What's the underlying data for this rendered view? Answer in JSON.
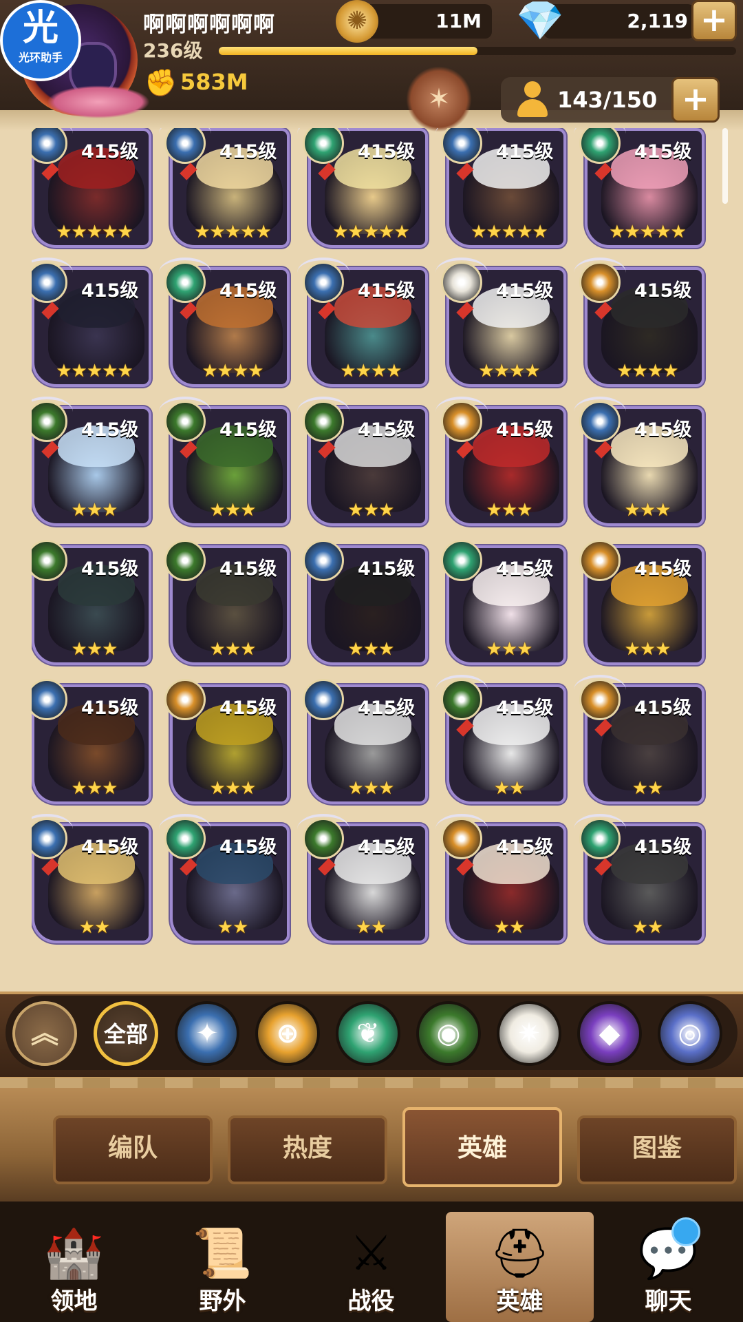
{
  "player": {
    "name": "啊啊啊啊啊啊",
    "level": "236级",
    "xp_progress": 0.5,
    "power": "583M"
  },
  "badge": {
    "glyph": "光",
    "text": "光环助手"
  },
  "currency": {
    "gold": "11M",
    "gems": "2,119",
    "plus": "+"
  },
  "roster": {
    "count": "143/150",
    "plus": "+"
  },
  "heroes": [
    {
      "level": "415级",
      "stars": "★★★★★",
      "faction": "lightbearer",
      "wings": true
    },
    {
      "level": "415级",
      "stars": "★★★★★",
      "faction": "lightbearer",
      "wings": true
    },
    {
      "level": "415级",
      "stars": "★★★★★",
      "faction": "wilder",
      "wings": true
    },
    {
      "level": "415级",
      "stars": "★★★★★",
      "faction": "lightbearer",
      "wings": true
    },
    {
      "level": "415级",
      "stars": "★★★★★",
      "faction": "wilder",
      "wings": true
    },
    {
      "level": "415级",
      "stars": "★★★★★",
      "faction": "lightbearer",
      "wings": true
    },
    {
      "level": "415级",
      "stars": "★★★★",
      "faction": "wilder",
      "wings": true
    },
    {
      "level": "415级",
      "stars": "★★★★",
      "faction": "lightbearer",
      "wings": true
    },
    {
      "level": "415级",
      "stars": "★★★★",
      "faction": "celestial",
      "wings": true
    },
    {
      "level": "415级",
      "stars": "★★★★",
      "faction": "mauler",
      "wings": true
    },
    {
      "level": "415级",
      "stars": "★★★",
      "faction": "graveborn",
      "wings": true
    },
    {
      "level": "415级",
      "stars": "★★★",
      "faction": "graveborn",
      "wings": true
    },
    {
      "level": "415级",
      "stars": "★★★",
      "faction": "graveborn",
      "wings": true
    },
    {
      "level": "415级",
      "stars": "★★★",
      "faction": "mauler",
      "wings": true
    },
    {
      "level": "415级",
      "stars": "★★★",
      "faction": "lightbearer",
      "wings": true
    },
    {
      "level": "415级",
      "stars": "★★★",
      "faction": "graveborn",
      "wings": false
    },
    {
      "level": "415级",
      "stars": "★★★",
      "faction": "graveborn",
      "wings": false
    },
    {
      "level": "415级",
      "stars": "★★★",
      "faction": "lightbearer",
      "wings": false
    },
    {
      "level": "415级",
      "stars": "★★★",
      "faction": "wilder",
      "wings": false
    },
    {
      "level": "415级",
      "stars": "★★★",
      "faction": "mauler",
      "wings": false
    },
    {
      "level": "415级",
      "stars": "★★★",
      "faction": "lightbearer",
      "wings": false
    },
    {
      "level": "415级",
      "stars": "★★★",
      "faction": "mauler",
      "wings": false
    },
    {
      "level": "415级",
      "stars": "★★★",
      "faction": "lightbearer",
      "wings": false
    },
    {
      "level": "415级",
      "stars": "★★",
      "faction": "graveborn",
      "wings": true
    },
    {
      "level": "415级",
      "stars": "★★",
      "faction": "mauler",
      "wings": true
    },
    {
      "level": "415级",
      "stars": "★★",
      "faction": "lightbearer",
      "wings": true
    },
    {
      "level": "415级",
      "stars": "★★",
      "faction": "wilder",
      "wings": true
    },
    {
      "level": "415级",
      "stars": "★★",
      "faction": "graveborn",
      "wings": true
    },
    {
      "level": "415级",
      "stars": "★★",
      "faction": "mauler",
      "wings": true
    },
    {
      "level": "415级",
      "stars": "★★",
      "faction": "wilder",
      "wings": true
    }
  ],
  "faction_colors": {
    "lightbearer": "#3b6fb0",
    "mauler": "#d9902a",
    "wilder": "#2fa372",
    "graveborn": "#3c7a2c",
    "celestial": "#e8e4da",
    "hypogean": "#6b3aa8",
    "dimensional": "#4a5fb0"
  },
  "filters": {
    "collapse_glyph": "︽",
    "all_label": "全部",
    "items": [
      {
        "name": "lightbearer",
        "color": "#3b6fb0",
        "glyph": "✦"
      },
      {
        "name": "mauler",
        "color": "#e8a22f",
        "glyph": "⊕"
      },
      {
        "name": "wilder",
        "color": "#2fa372",
        "glyph": "❦"
      },
      {
        "name": "graveborn",
        "color": "#3c7a2c",
        "glyph": "◉"
      },
      {
        "name": "celestial",
        "color": "#f0ece2",
        "glyph": "✷"
      },
      {
        "name": "hypogean",
        "color": "#7a3fbf",
        "glyph": "◆"
      },
      {
        "name": "dimensional",
        "color": "#5a6fc8",
        "glyph": "◎"
      }
    ]
  },
  "tabs": [
    "编队",
    "热度",
    "英雄",
    "图鉴"
  ],
  "active_tab": 2,
  "nav": [
    {
      "label": "领地",
      "icon": "castle-icon",
      "glyph": "🏰"
    },
    {
      "label": "野外",
      "icon": "map-scroll-icon",
      "glyph": "📜"
    },
    {
      "label": "战役",
      "icon": "battle-sword-icon",
      "glyph": "⚔"
    },
    {
      "label": "英雄",
      "icon": "helmet-icon",
      "glyph": "⛑"
    },
    {
      "label": "聊天",
      "icon": "chat-icon",
      "glyph": "💬"
    }
  ],
  "active_nav": 3
}
